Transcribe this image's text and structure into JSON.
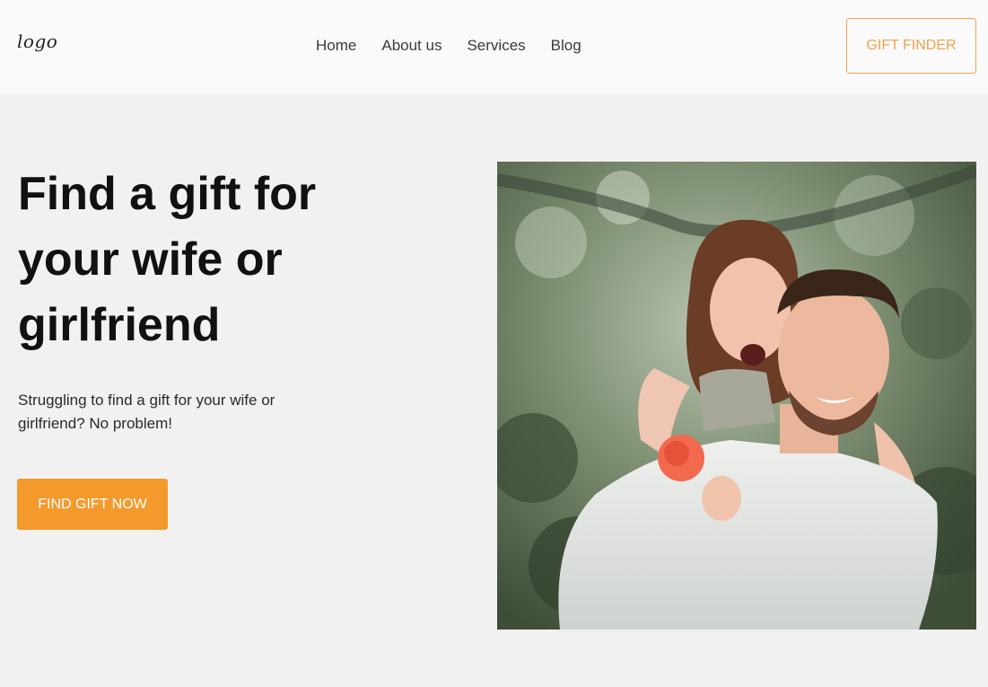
{
  "header": {
    "logo_text": "logo",
    "nav": [
      "Home",
      "About us",
      "Services",
      "Blog"
    ],
    "gift_finder_label": "GIFT FINDER"
  },
  "hero": {
    "title": "Find a gift for your wife or girlfriend",
    "subtitle": "Struggling to find a gift for your wife or girlfriend? No problem!",
    "cta_label": "FIND GIFT NOW"
  },
  "colors": {
    "accent": "#f49a2c",
    "header_bg": "#fafafa",
    "page_bg": "#f1f1f1"
  }
}
